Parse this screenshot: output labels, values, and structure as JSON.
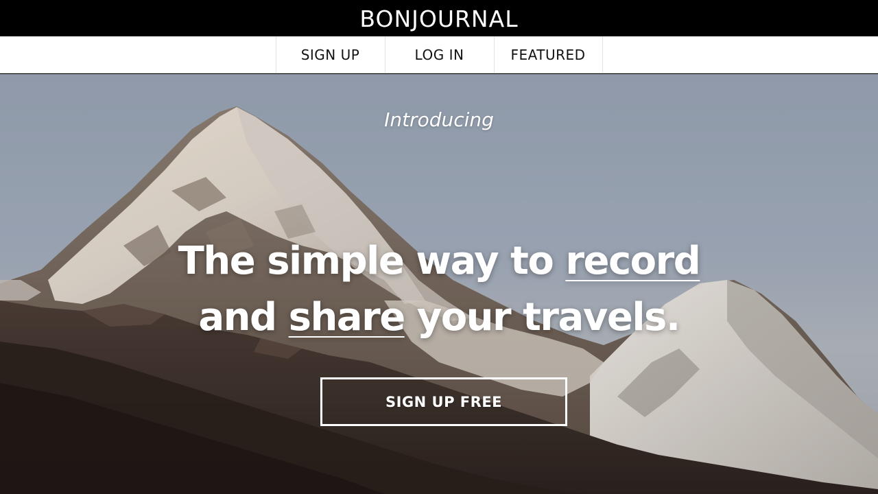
{
  "header": {
    "brand": "BONJOURNAL"
  },
  "nav": {
    "items": [
      {
        "label": "SIGN UP"
      },
      {
        "label": "LOG IN"
      },
      {
        "label": "FEATURED"
      }
    ]
  },
  "hero": {
    "intro": "Introducing",
    "headline": {
      "line1_a": "The simple way to ",
      "line1_link": "record",
      "line2_a": "and ",
      "line2_link": "share",
      "line2_b": " your travels."
    },
    "cta_label": "SIGN UP FREE"
  }
}
